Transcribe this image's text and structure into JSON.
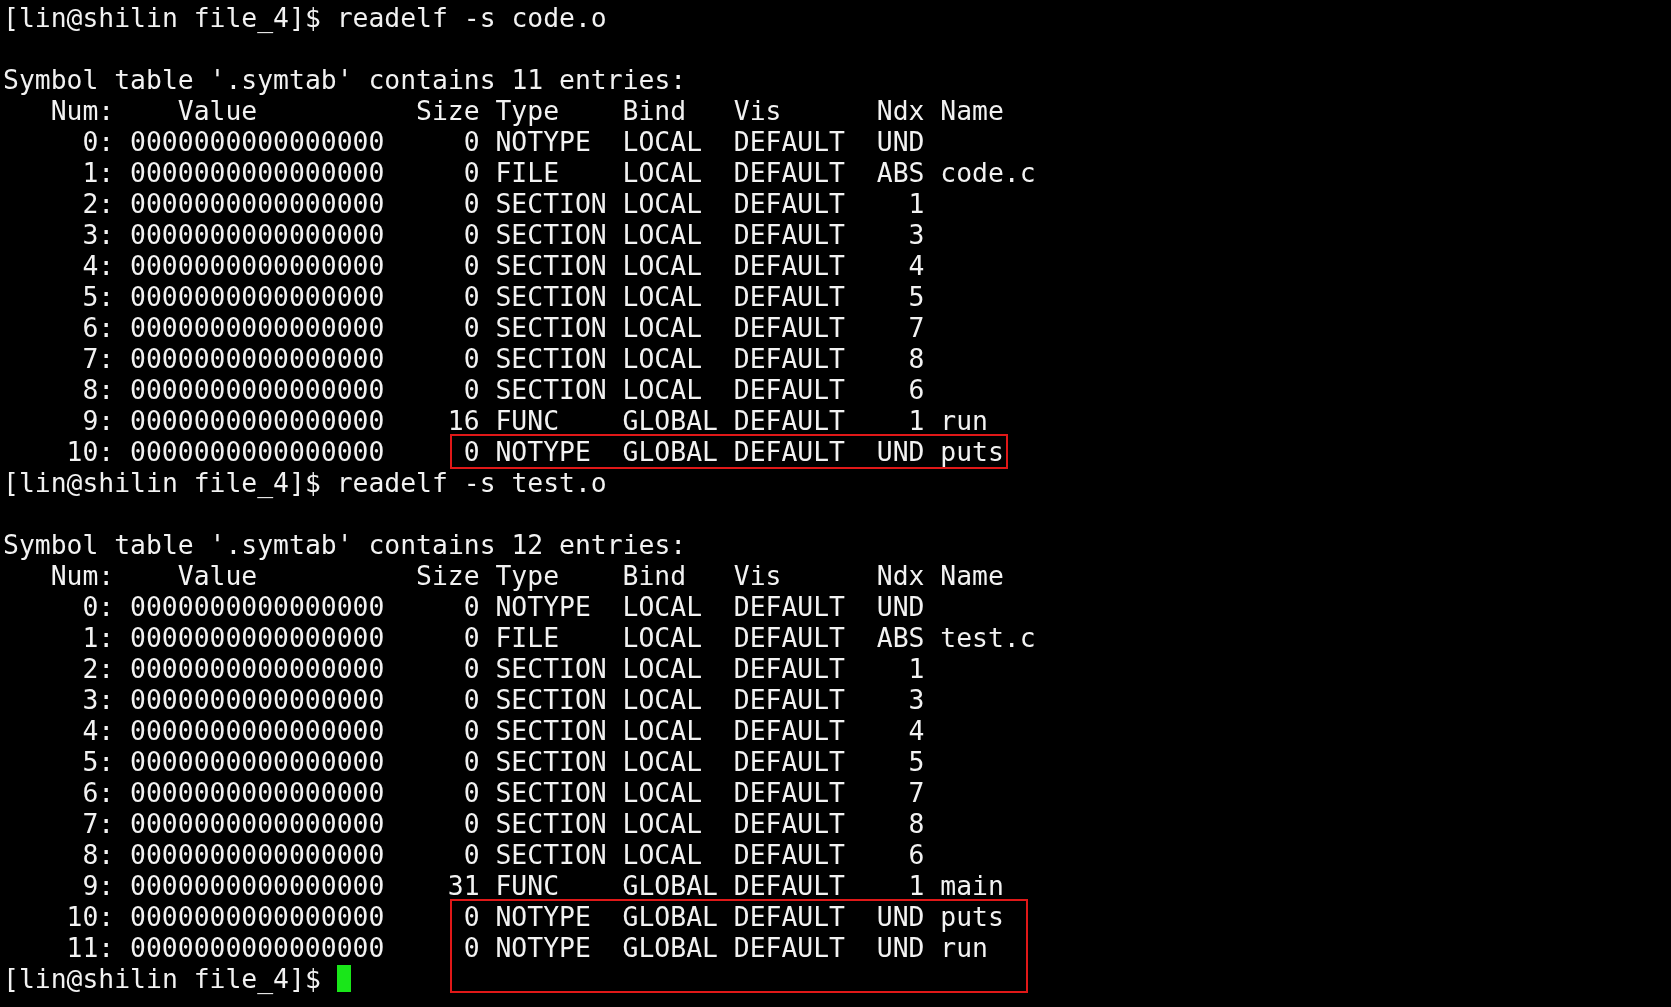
{
  "terminal": {
    "sessions": [
      {
        "prompt": "[lin@shilin file_4]$",
        "command": "readelf -s code.o",
        "heading": "Symbol table '.symtab' contains 11 entries:",
        "columns": [
          "Num:",
          "Value",
          "Size",
          "Type",
          "Bind",
          "Vis",
          "Ndx",
          "Name"
        ],
        "rows": [
          {
            "num": "0:",
            "value": "0000000000000000",
            "size": "0",
            "type": "NOTYPE",
            "bind": "LOCAL",
            "vis": "DEFAULT",
            "ndx": "UND",
            "highlighted": false
          },
          {
            "num": "1:",
            "value": "0000000000000000",
            "size": "0",
            "type": "FILE",
            "bind": "LOCAL",
            "vis": "DEFAULT",
            "ndx": "ABS",
            "name": "code.c",
            "highlighted": false
          },
          {
            "num": "2:",
            "value": "0000000000000000",
            "size": "0",
            "type": "SECTION",
            "bind": "LOCAL",
            "vis": "DEFAULT",
            "ndx": "1",
            "highlighted": false
          },
          {
            "num": "3:",
            "value": "0000000000000000",
            "size": "0",
            "type": "SECTION",
            "bind": "LOCAL",
            "vis": "DEFAULT",
            "ndx": "3",
            "highlighted": false
          },
          {
            "num": "4:",
            "value": "0000000000000000",
            "size": "0",
            "type": "SECTION",
            "bind": "LOCAL",
            "vis": "DEFAULT",
            "ndx": "4",
            "highlighted": false
          },
          {
            "num": "5:",
            "value": "0000000000000000",
            "size": "0",
            "type": "SECTION",
            "bind": "LOCAL",
            "vis": "DEFAULT",
            "ndx": "5",
            "highlighted": false
          },
          {
            "num": "6:",
            "value": "0000000000000000",
            "size": "0",
            "type": "SECTION",
            "bind": "LOCAL",
            "vis": "DEFAULT",
            "ndx": "7",
            "highlighted": false
          },
          {
            "num": "7:",
            "value": "0000000000000000",
            "size": "0",
            "type": "SECTION",
            "bind": "LOCAL",
            "vis": "DEFAULT",
            "ndx": "8",
            "highlighted": false
          },
          {
            "num": "8:",
            "value": "0000000000000000",
            "size": "0",
            "type": "SECTION",
            "bind": "LOCAL",
            "vis": "DEFAULT",
            "ndx": "6",
            "highlighted": false
          },
          {
            "num": "9:",
            "value": "0000000000000000",
            "size": "16",
            "type": "FUNC",
            "bind": "GLOBAL",
            "vis": "DEFAULT",
            "ndx": "1",
            "name": "run",
            "highlighted": false
          },
          {
            "num": "10:",
            "value": "0000000000000000",
            "size": "0",
            "type": "NOTYPE",
            "bind": "GLOBAL",
            "vis": "DEFAULT",
            "ndx": "UND",
            "name": "puts",
            "highlighted": true
          }
        ]
      },
      {
        "prompt": "[lin@shilin file_4]$",
        "command": "readelf -s test.o",
        "heading": "Symbol table '.symtab' contains 12 entries:",
        "columns": [
          "Num:",
          "Value",
          "Size",
          "Type",
          "Bind",
          "Vis",
          "Ndx",
          "Name"
        ],
        "rows": [
          {
            "num": "0:",
            "value": "0000000000000000",
            "size": "0",
            "type": "NOTYPE",
            "bind": "LOCAL",
            "vis": "DEFAULT",
            "ndx": "UND",
            "highlighted": false
          },
          {
            "num": "1:",
            "value": "0000000000000000",
            "size": "0",
            "type": "FILE",
            "bind": "LOCAL",
            "vis": "DEFAULT",
            "ndx": "ABS",
            "name": "test.c",
            "highlighted": false
          },
          {
            "num": "2:",
            "value": "0000000000000000",
            "size": "0",
            "type": "SECTION",
            "bind": "LOCAL",
            "vis": "DEFAULT",
            "ndx": "1",
            "highlighted": false
          },
          {
            "num": "3:",
            "value": "0000000000000000",
            "size": "0",
            "type": "SECTION",
            "bind": "LOCAL",
            "vis": "DEFAULT",
            "ndx": "3",
            "highlighted": false
          },
          {
            "num": "4:",
            "value": "0000000000000000",
            "size": "0",
            "type": "SECTION",
            "bind": "LOCAL",
            "vis": "DEFAULT",
            "ndx": "4",
            "highlighted": false
          },
          {
            "num": "5:",
            "value": "0000000000000000",
            "size": "0",
            "type": "SECTION",
            "bind": "LOCAL",
            "vis": "DEFAULT",
            "ndx": "5",
            "highlighted": false
          },
          {
            "num": "6:",
            "value": "0000000000000000",
            "size": "0",
            "type": "SECTION",
            "bind": "LOCAL",
            "vis": "DEFAULT",
            "ndx": "7",
            "highlighted": false
          },
          {
            "num": "7:",
            "value": "0000000000000000",
            "size": "0",
            "type": "SECTION",
            "bind": "LOCAL",
            "vis": "DEFAULT",
            "ndx": "8",
            "highlighted": false
          },
          {
            "num": "8:",
            "value": "0000000000000000",
            "size": "0",
            "type": "SECTION",
            "bind": "LOCAL",
            "vis": "DEFAULT",
            "ndx": "6",
            "highlighted": false
          },
          {
            "num": "9:",
            "value": "0000000000000000",
            "size": "31",
            "type": "FUNC",
            "bind": "GLOBAL",
            "vis": "DEFAULT",
            "ndx": "1",
            "name": "main",
            "highlighted": false
          },
          {
            "num": "10:",
            "value": "0000000000000000",
            "size": "0",
            "type": "NOTYPE",
            "bind": "GLOBAL",
            "vis": "DEFAULT",
            "ndx": "UND",
            "name": "puts",
            "highlighted": true
          },
          {
            "num": "11:",
            "value": "0000000000000000",
            "size": "0",
            "type": "NOTYPE",
            "bind": "GLOBAL",
            "vis": "DEFAULT",
            "ndx": "UND",
            "name": "run",
            "highlighted": true
          }
        ]
      }
    ],
    "final_prompt": {
      "prompt": "[lin@shilin file_4]$",
      "cursor": true
    }
  }
}
